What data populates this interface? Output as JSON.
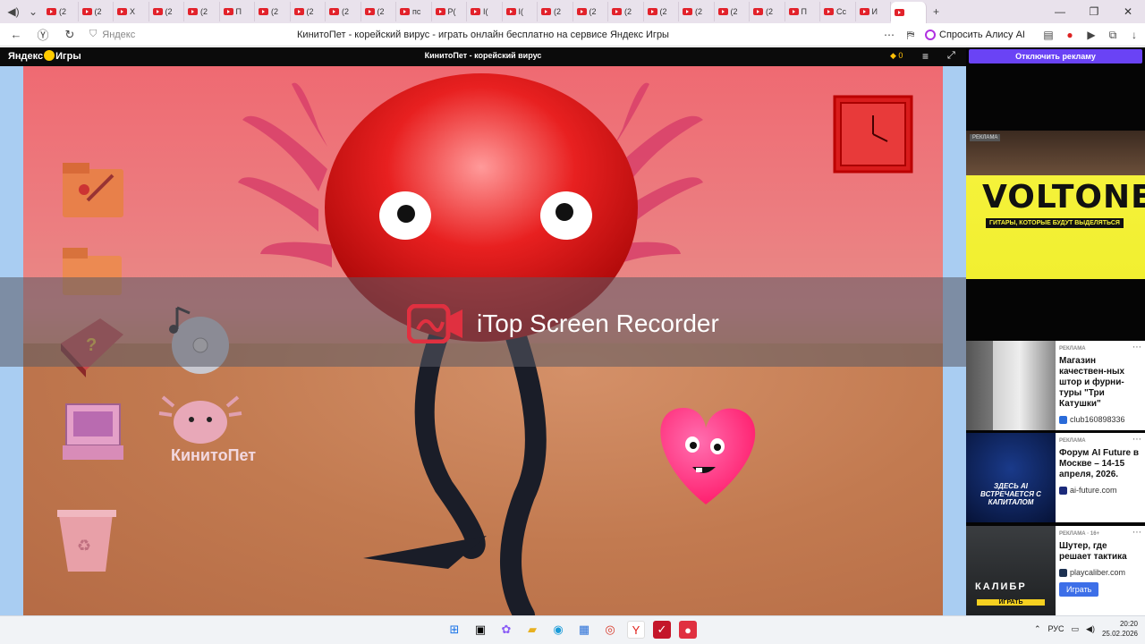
{
  "browser": {
    "tabs": [
      "(2",
      "(2",
      "X",
      "(2",
      "(2",
      "П",
      "(2",
      "(2",
      "(2",
      "(2",
      "пс",
      "Р(",
      "I(",
      "I(",
      "(2",
      "(2",
      "(2",
      "(2",
      "(2",
      "(2",
      "(2",
      "П",
      "Cc",
      "И",
      ""
    ],
    "address_placeholder": "Яндекс",
    "page_title": "КинитоПет - корейский вирус - играть онлайн бесплатно на сервисе Яндекс Игры",
    "alisa_label": "Спросить Алису AI"
  },
  "game_bar": {
    "logo_text": "Яндекс",
    "logo_text2": "Игры",
    "title": "КинитоПет - корейский вирус",
    "coins": "0"
  },
  "game": {
    "pet_label": "КинитоПет",
    "recorder_text": "iTop Screen Recorder",
    "colors": {
      "creature": "#e01818",
      "heart": "#ff2d7a",
      "limbs": "#1a1d28"
    }
  },
  "ads": {
    "disable_label": "Отключить рекламу",
    "banner": {
      "label": "РЕКЛАМА",
      "title": "VOLTONE",
      "subtitle": "ГИТАРЫ, КОТОРЫЕ БУДУТ ВЫДЕЛЯТЬСЯ"
    },
    "items": [
      {
        "label": "РЕКЛАМА",
        "headline": "Магазин качествен-ных штор и фурни-туры \"Три Катушки\"",
        "domain": "club160898336"
      },
      {
        "label": "РЕКЛАМА",
        "headline": "Форум AI Future в Москве – 14-15 апреля, 2026.",
        "domain": "ai-future.com",
        "img_text": "ЗДЕСЬ AI ВСТРЕЧАЕТСЯ С КАПИТАЛОМ"
      },
      {
        "label": "РЕКЛАМА · 16+",
        "headline": "Шутер, где решает тактика",
        "domain": "playcaliber.com",
        "button": "Играть",
        "img_text": "КАЛИБР",
        "img_btn": "ИГРАТЬ"
      }
    ]
  },
  "taskbar": {
    "lang": "РУС",
    "time": "20:20",
    "date": "25.02.2026"
  }
}
